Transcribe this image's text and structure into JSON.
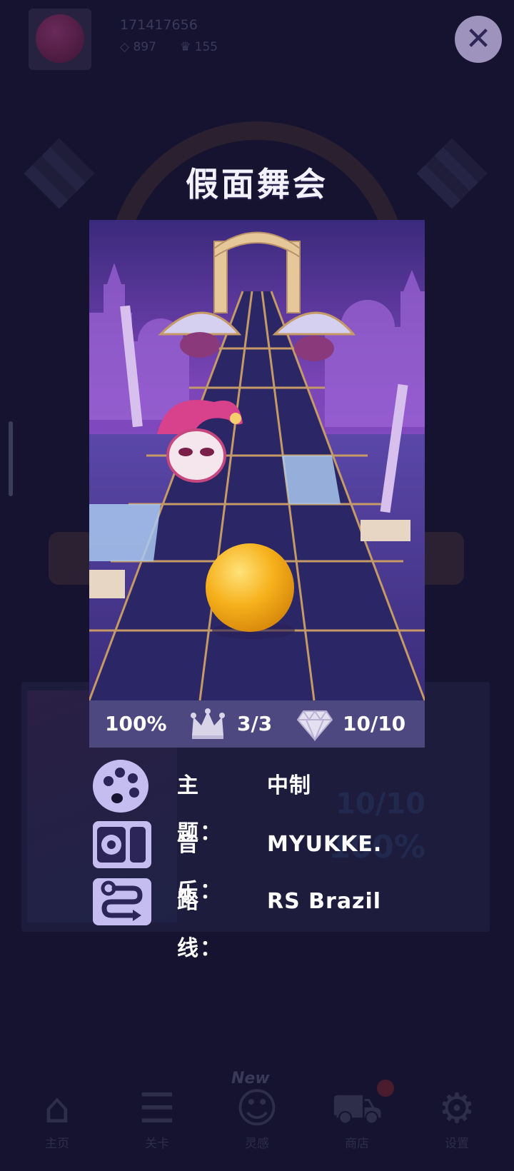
{
  "background": {
    "player_id": "171417656",
    "diamonds": "897",
    "crowns": "155",
    "ghost_score": "10/10",
    "ghost_percent": "100%",
    "new_badge": "New",
    "nav": [
      {
        "icon": "home-icon",
        "label": "主页"
      },
      {
        "icon": "list-icon",
        "label": "关卡"
      },
      {
        "icon": "bulb-icon",
        "label": "灵感"
      },
      {
        "icon": "cart-icon",
        "label": "商店"
      },
      {
        "icon": "gear-icon",
        "label": "设置"
      }
    ]
  },
  "level": {
    "title": "假面舞会",
    "progress": "100%",
    "crowns": "3/3",
    "diamonds": "10/10"
  },
  "info": [
    {
      "icon": "palette-icon",
      "label": "主题：",
      "value": "中制"
    },
    {
      "icon": "music-icon",
      "label": "音乐：",
      "value": "MYUKKE."
    },
    {
      "icon": "route-icon",
      "label": "路线：",
      "value": "RS Brazil"
    }
  ],
  "colors": {
    "backdrop": "#15132f",
    "stats_bar": "#4d4880",
    "icon_tile": "#c5bdf0",
    "ball": "#f6b11c",
    "close_button": "#9d93bd"
  }
}
